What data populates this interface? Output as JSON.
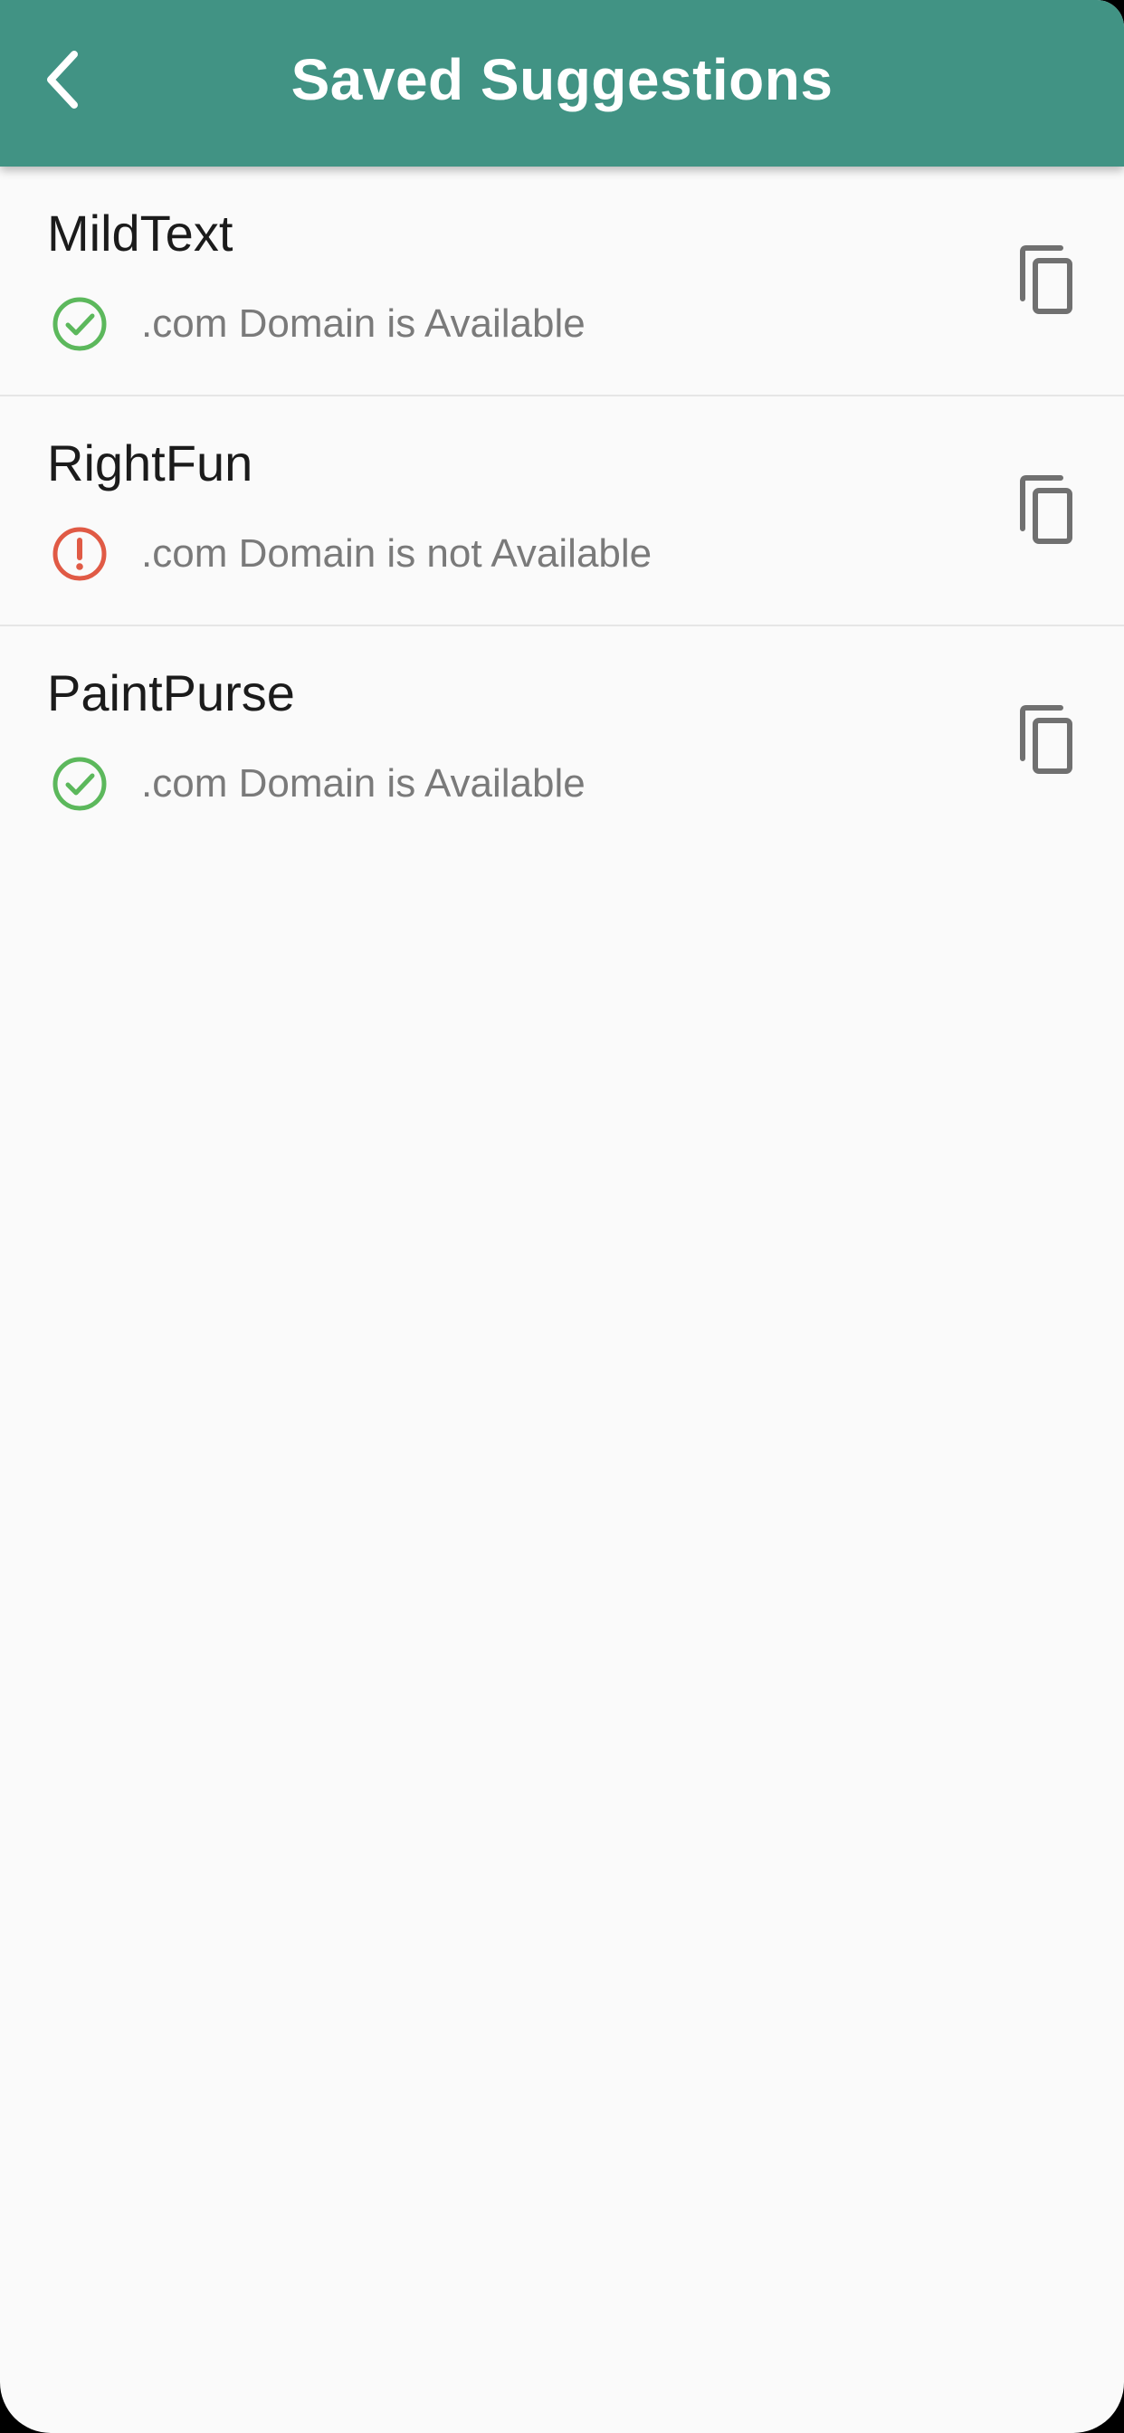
{
  "app_bar": {
    "title": "Saved Suggestions",
    "back_icon": "chevron-left-icon",
    "background_color": "#419384"
  },
  "suggestions": [
    {
      "name": "MildText",
      "status_text": ".com Domain is Available",
      "status": "available",
      "status_icon": "check-circle-icon",
      "status_color": "#5cb85c",
      "action_icon": "copy-icon"
    },
    {
      "name": "RightFun",
      "status_text": ".com Domain is not Available",
      "status": "not-available",
      "status_icon": "alert-circle-icon",
      "status_color": "#e05a45",
      "action_icon": "copy-icon"
    },
    {
      "name": "PaintPurse",
      "status_text": ".com Domain is Available",
      "status": "available",
      "status_icon": "check-circle-icon",
      "status_color": "#5cb85c",
      "action_icon": "copy-icon"
    }
  ]
}
